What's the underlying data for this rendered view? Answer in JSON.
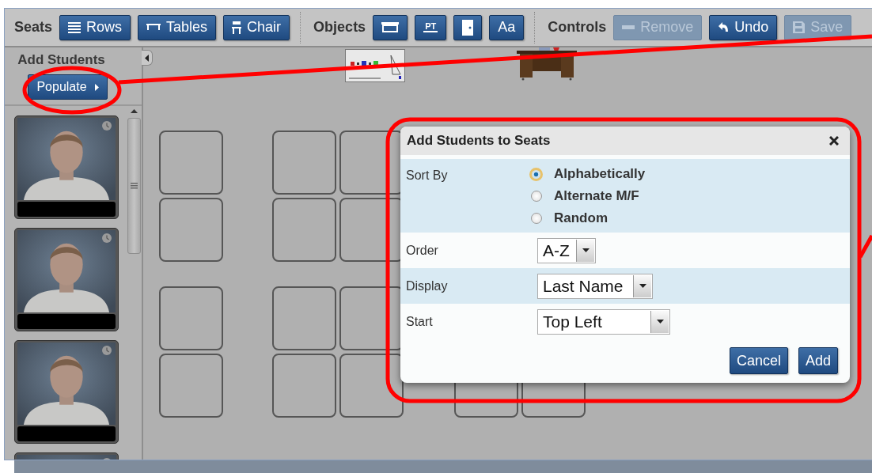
{
  "toolbar": {
    "groups": [
      {
        "label": "Seats",
        "buttons": [
          {
            "kind": "rows",
            "label": "Rows",
            "disabled": false
          },
          {
            "kind": "tables",
            "label": "Tables",
            "disabled": false
          },
          {
            "kind": "chair",
            "label": "Chair",
            "disabled": false
          }
        ]
      },
      {
        "label": "Objects",
        "buttons": [
          {
            "kind": "whiteboard",
            "disabled": false
          },
          {
            "kind": "projector",
            "label": "PT",
            "disabled": false
          },
          {
            "kind": "door",
            "disabled": false
          },
          {
            "kind": "text",
            "label": "Aa",
            "disabled": false
          }
        ]
      },
      {
        "label": "Controls",
        "buttons": [
          {
            "kind": "minus",
            "label": "Remove",
            "disabled": true
          },
          {
            "kind": "undo",
            "label": "Undo",
            "disabled": false
          },
          {
            "kind": "save",
            "label": "Save",
            "disabled": true
          }
        ]
      }
    ]
  },
  "sidebar": {
    "title": "Add Students",
    "populate_button": "Populate"
  },
  "dialog": {
    "title": "Add Students to Seats",
    "sort_by": {
      "label": "Sort By",
      "options": [
        {
          "label": "Alphabetically",
          "selected": true
        },
        {
          "label": "Alternate M/F",
          "selected": false
        },
        {
          "label": "Random",
          "selected": false
        }
      ]
    },
    "fields": [
      {
        "label": "Order",
        "value": "A-Z"
      },
      {
        "label": "Display",
        "value": "Last Name"
      },
      {
        "label": "Start",
        "value": "Top Left"
      }
    ],
    "buttons": [
      "Cancel",
      "Add"
    ]
  }
}
